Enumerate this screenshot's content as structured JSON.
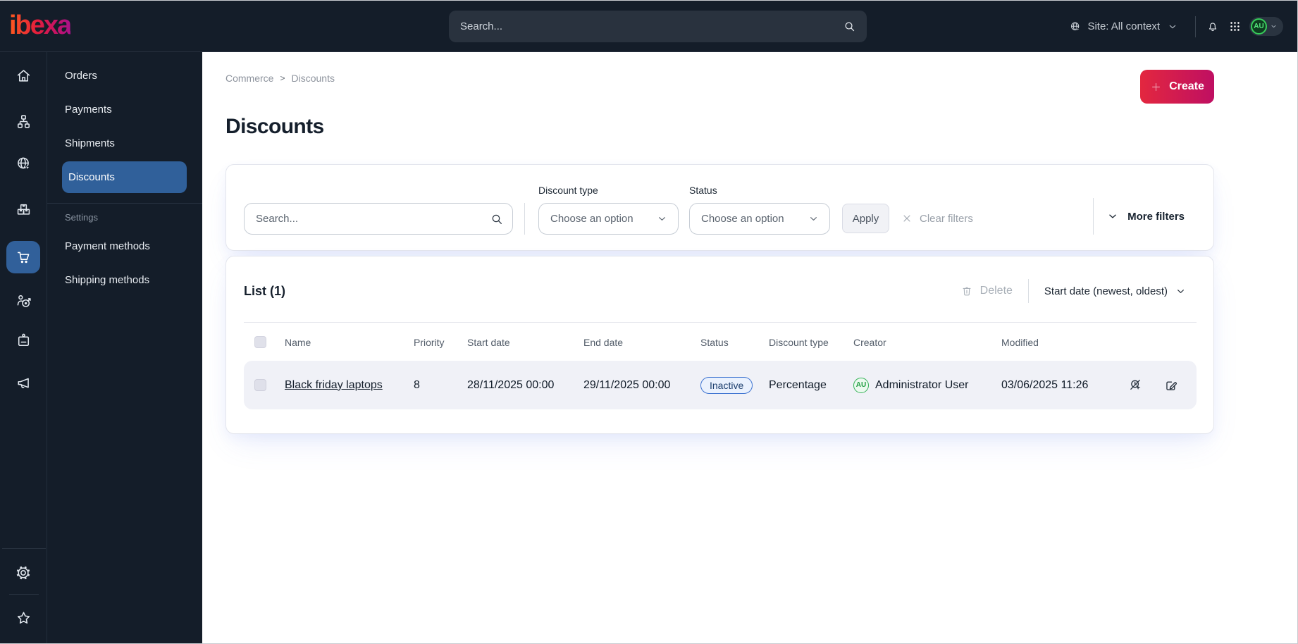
{
  "topbar": {
    "logo": "ibexa",
    "search_placeholder": "Search...",
    "site_context": "Site: All context",
    "avatar_initials": "AU"
  },
  "sidebar": {
    "icons": [
      "home",
      "site-structure",
      "globe-browse",
      "products",
      "commerce-cart",
      "personalization-target",
      "id-badge",
      "marketing-megaphone",
      "settings-gear",
      "bookmarks-star"
    ],
    "active_icon": "commerce-cart"
  },
  "menu": {
    "items": [
      "Orders",
      "Payments",
      "Shipments",
      "Discounts"
    ],
    "active_item": "Discounts",
    "settings_label": "Settings",
    "settings_items": [
      "Payment methods",
      "Shipping methods"
    ]
  },
  "breadcrumb": {
    "items": [
      "Commerce",
      "Discounts"
    ],
    "separator": ">"
  },
  "page": {
    "title": "Discounts",
    "create_label": "Create"
  },
  "filters": {
    "search_placeholder": "Search...",
    "discount_type_label": "Discount type",
    "discount_type_value": "Choose an option",
    "status_label": "Status",
    "status_value": "Choose an option",
    "apply_label": "Apply",
    "clear_label": "Clear filters",
    "more_label": "More filters"
  },
  "list": {
    "title": "List (1)",
    "delete_label": "Delete",
    "sort_label": "Start date (newest, oldest)",
    "columns": [
      "Name",
      "Priority",
      "Start date",
      "End date",
      "Status",
      "Discount type",
      "Creator",
      "Modified"
    ],
    "rows": [
      {
        "name": "Black friday laptops",
        "priority": "8",
        "start_date": "28/11/2025 00:00",
        "end_date": "29/11/2025 00:00",
        "status": "Inactive",
        "discount_type": "Percentage",
        "creator_initials": "AU",
        "creator": "Administrator User",
        "modified": "03/06/2025 11:26"
      }
    ]
  },
  "colors": {
    "topbar_bg": "#141d29",
    "active_blue": "#30609a",
    "create_gradient": [
      "#e3273f",
      "#bf0f62"
    ],
    "badge_border": "#3f74d1",
    "avatar_green": "#35b257",
    "row_bg": "#f0f1f7"
  }
}
